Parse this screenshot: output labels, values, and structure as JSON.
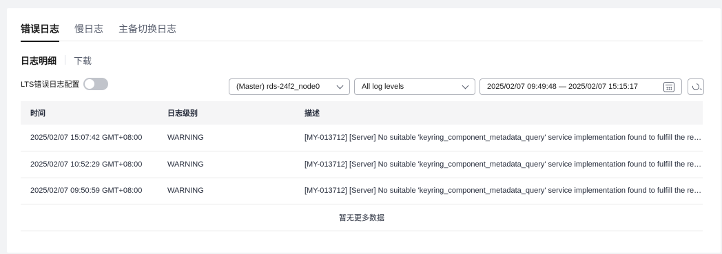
{
  "tabs": [
    "错误日志",
    "慢日志",
    "主备切换日志"
  ],
  "subtabs": [
    "日志明细",
    "下载"
  ],
  "lts": {
    "label": "LTS错误日志配置",
    "enabled": false
  },
  "filters": {
    "instance": "(Master) rds-24f2_node0",
    "level": "All log levels",
    "date_range": "2025/02/07 09:49:48 — 2025/02/07 15:15:17"
  },
  "table": {
    "columns": [
      "时间",
      "日志级别",
      "描述"
    ],
    "rows": [
      [
        "2025/02/07 15:07:42 GMT+08:00",
        "WARNING",
        "[MY-013712] [Server] No suitable 'keyring_component_metadata_query' service implementation found to fulfill the req..."
      ],
      [
        "2025/02/07 10:52:29 GMT+08:00",
        "WARNING",
        "[MY-013712] [Server] No suitable 'keyring_component_metadata_query' service implementation found to fulfill the req..."
      ],
      [
        "2025/02/07 09:50:59 GMT+08:00",
        "WARNING",
        "[MY-013712] [Server] No suitable 'keyring_component_metadata_query' service implementation found to fulfill the req..."
      ]
    ],
    "footer": "暂无更多数据"
  },
  "icons": {
    "instance_dropdown": "chevron-down-icon",
    "level_dropdown": "chevron-down-icon",
    "date": "calendar-icon",
    "refresh": "refresh-icon"
  }
}
